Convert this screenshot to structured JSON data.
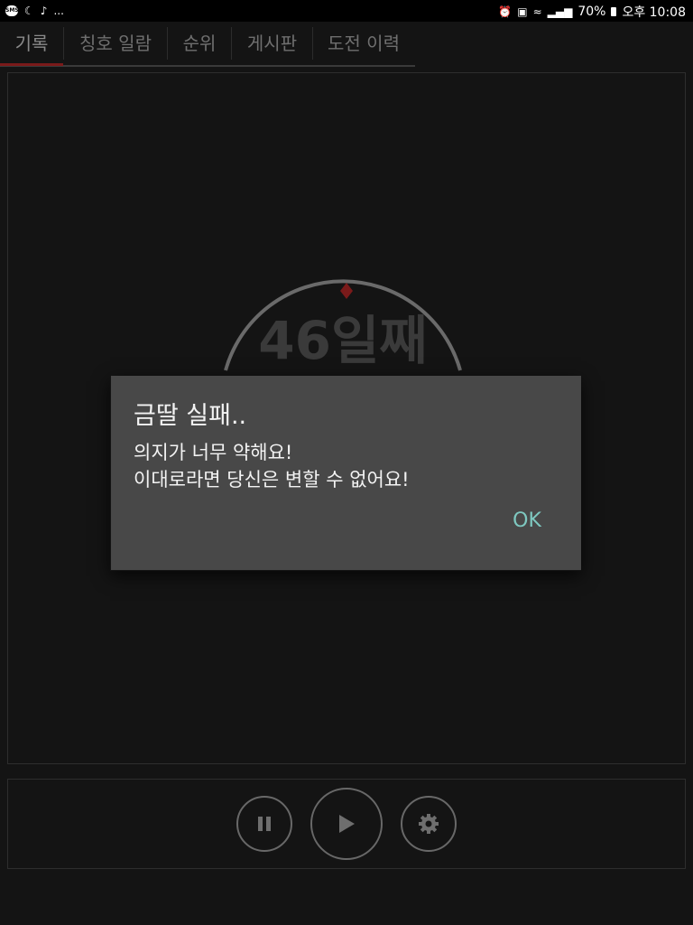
{
  "status_bar": {
    "left_icons": [
      "sms-icon",
      "moon-icon",
      "music-note-icon"
    ],
    "overflow": "...",
    "right_icons": [
      "alarm-icon",
      "nfc-icon",
      "wifi-icon",
      "signal-icon"
    ],
    "battery": "70%",
    "time": "오후 10:08"
  },
  "tabs": [
    {
      "label": "기록",
      "active": true
    },
    {
      "label": "칭호 일람",
      "active": false
    },
    {
      "label": "순위",
      "active": false
    },
    {
      "label": "게시판",
      "active": false
    },
    {
      "label": "도전 이력",
      "active": false
    }
  ],
  "main": {
    "day_count": "46일째"
  },
  "dialog": {
    "title": "금딸 실패..",
    "message_lines": [
      "의지가 너무 약해요!",
      "이대로라면 당신은 변할 수 없어요!"
    ],
    "ok_label": "OK"
  },
  "controls": {
    "buttons": [
      "pause-icon",
      "play-icon",
      "gear-icon"
    ]
  },
  "colors": {
    "accent_red": "#7a1a1a",
    "dialog_bg": "#484848",
    "ok_text": "#7ec8c0"
  }
}
